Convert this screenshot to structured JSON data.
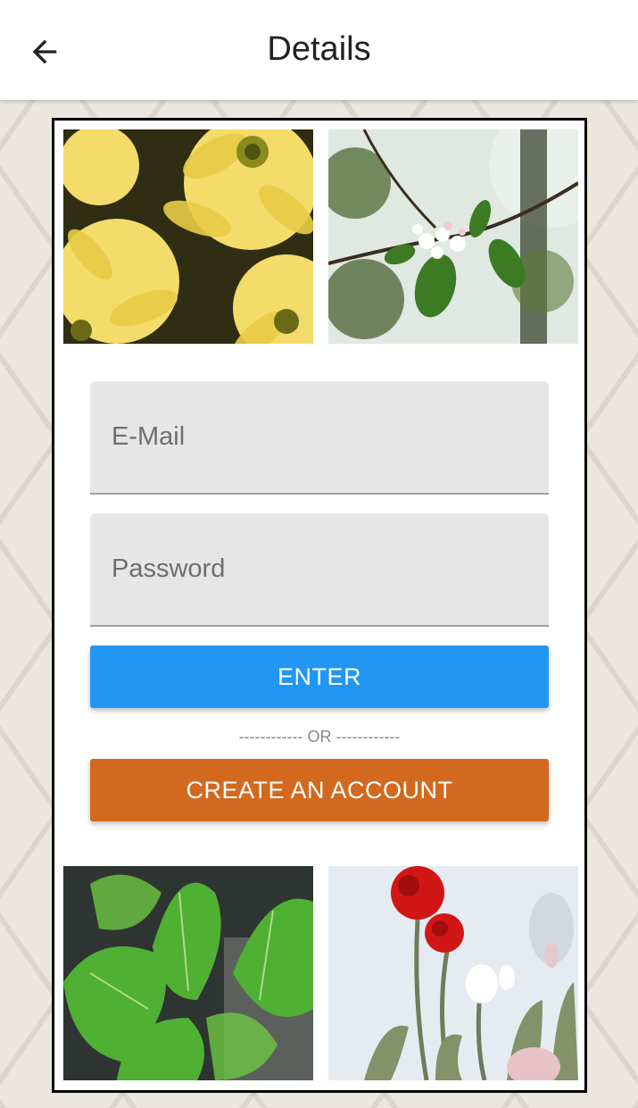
{
  "appbar": {
    "title": "Details",
    "back_icon": "arrow-left-icon"
  },
  "form": {
    "email_placeholder": "E-Mail",
    "password_placeholder": "Password",
    "enter_label": "ENTER",
    "separator": "------------   OR   ------------",
    "create_label": "CREATE AN ACCOUNT"
  },
  "photos": [
    {
      "subject": "yellow-chrysanthemums"
    },
    {
      "subject": "white-blossom-branch"
    },
    {
      "subject": "green-elephant-ear-leaves"
    },
    {
      "subject": "red-and-white-tulips"
    }
  ],
  "colors": {
    "enter_button": "#2196f3",
    "create_button": "#d2691e",
    "field_bg": "#e6e6e6"
  }
}
